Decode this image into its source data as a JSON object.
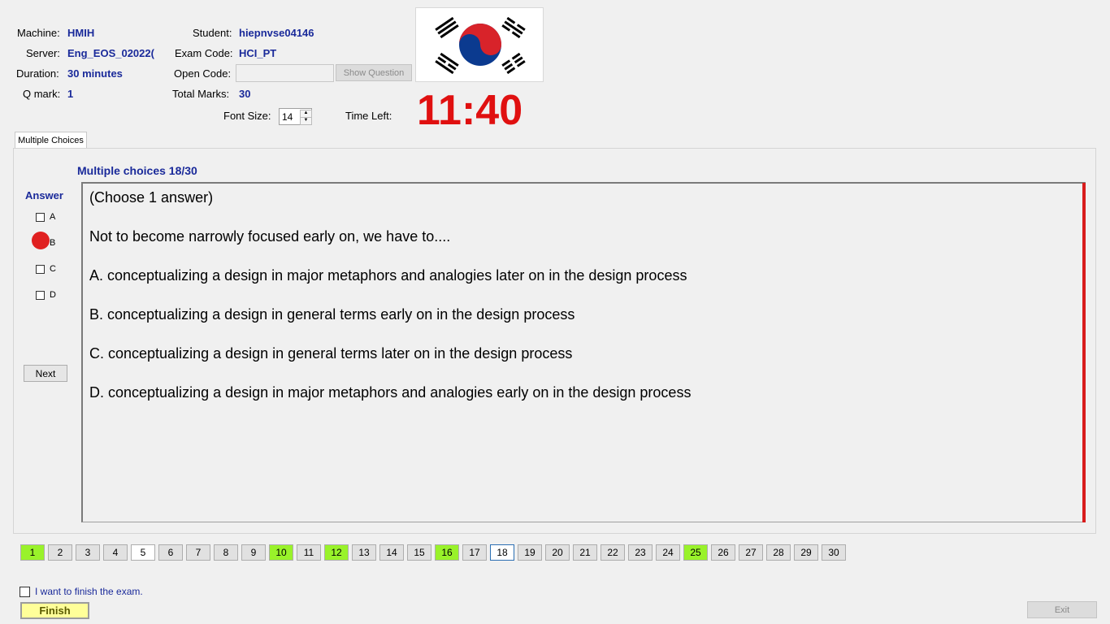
{
  "header": {
    "machine_label": "Machine:",
    "machine_value": "HMIH",
    "server_label": "Server:",
    "server_value": "Eng_EOS_02022(",
    "duration_label": "Duration:",
    "duration_value": "30 minutes",
    "qmark_label": "Q mark:",
    "qmark_value": "1",
    "student_label": "Student:",
    "student_value": "hiepnvse04146",
    "exam_code_label": "Exam Code:",
    "exam_code_value": "HCI_PT",
    "open_code_label": "Open Code:",
    "open_code_value": "",
    "show_question_label": "Show Question",
    "total_marks_label": "Total Marks:",
    "total_marks_value": "30",
    "font_size_label": "Font Size:",
    "font_size_value": "14",
    "time_left_label": "Time Left:",
    "time_left_value": "11:40"
  },
  "tabs": [
    {
      "label": "Multiple Choices"
    }
  ],
  "question": {
    "counter": "Multiple choices 18/30",
    "instruction": "(Choose 1 answer)",
    "stem": "Not to become narrowly focused early on, we have to....",
    "options": [
      "A.  conceptualizing a design in major metaphors and analogies later on in the design process",
      "B.  conceptualizing a design in general terms early on in the design process",
      "C.  conceptualizing a design in general terms later on in the design process",
      "D.  conceptualizing a design in major metaphors and analogies early on in the design process"
    ]
  },
  "answer_panel": {
    "title": "Answer",
    "choices": [
      "A",
      "B",
      "C",
      "D"
    ],
    "next_label": "Next"
  },
  "navigation": {
    "questions": [
      "1",
      "2",
      "3",
      "4",
      "5",
      "6",
      "7",
      "8",
      "9",
      "10",
      "11",
      "12",
      "13",
      "14",
      "15",
      "16",
      "17",
      "18",
      "19",
      "20",
      "21",
      "22",
      "23",
      "24",
      "25",
      "26",
      "27",
      "28",
      "29",
      "30"
    ],
    "answered": [
      1,
      10,
      12,
      16,
      25
    ],
    "current": 18
  },
  "footer": {
    "finish_check_label": "I want to finish the exam.",
    "finish_label": "Finish",
    "exit_label": "Exit"
  },
  "colors": {
    "value_blue": "#1a2a9a",
    "timer_red": "#e01010",
    "answered_green": "#99f22a",
    "finish_yellow": "#ffff99"
  }
}
